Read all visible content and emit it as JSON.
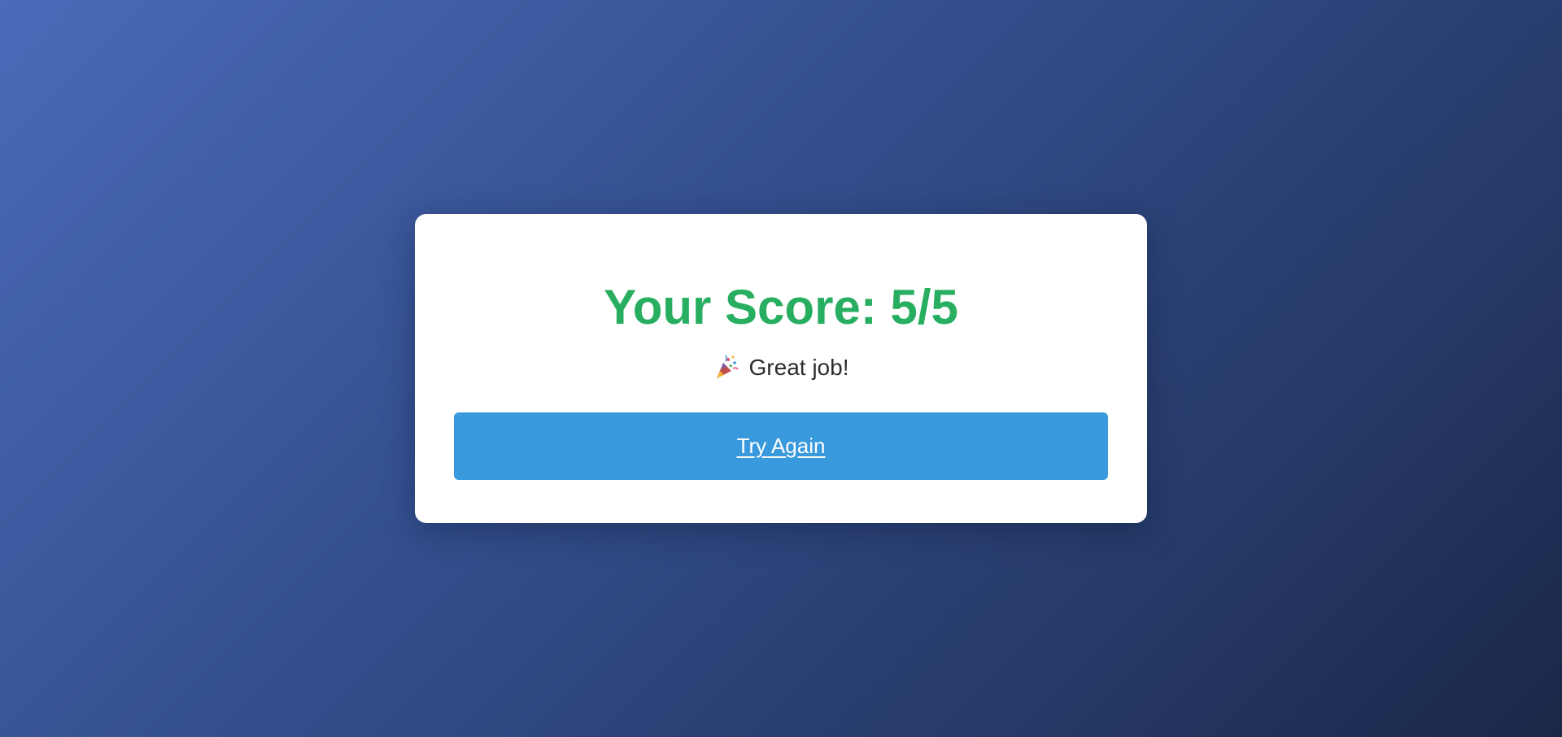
{
  "result": {
    "score_title": "Your Score: 5/5",
    "message": "Great job!",
    "icon": "party-popper-icon",
    "button_label": "Try Again"
  },
  "colors": {
    "score_text": "#27ae60",
    "button_bg": "#3899dc",
    "card_bg": "#ffffff",
    "background_start": "#4a6bb8",
    "background_end": "#1b2748"
  }
}
